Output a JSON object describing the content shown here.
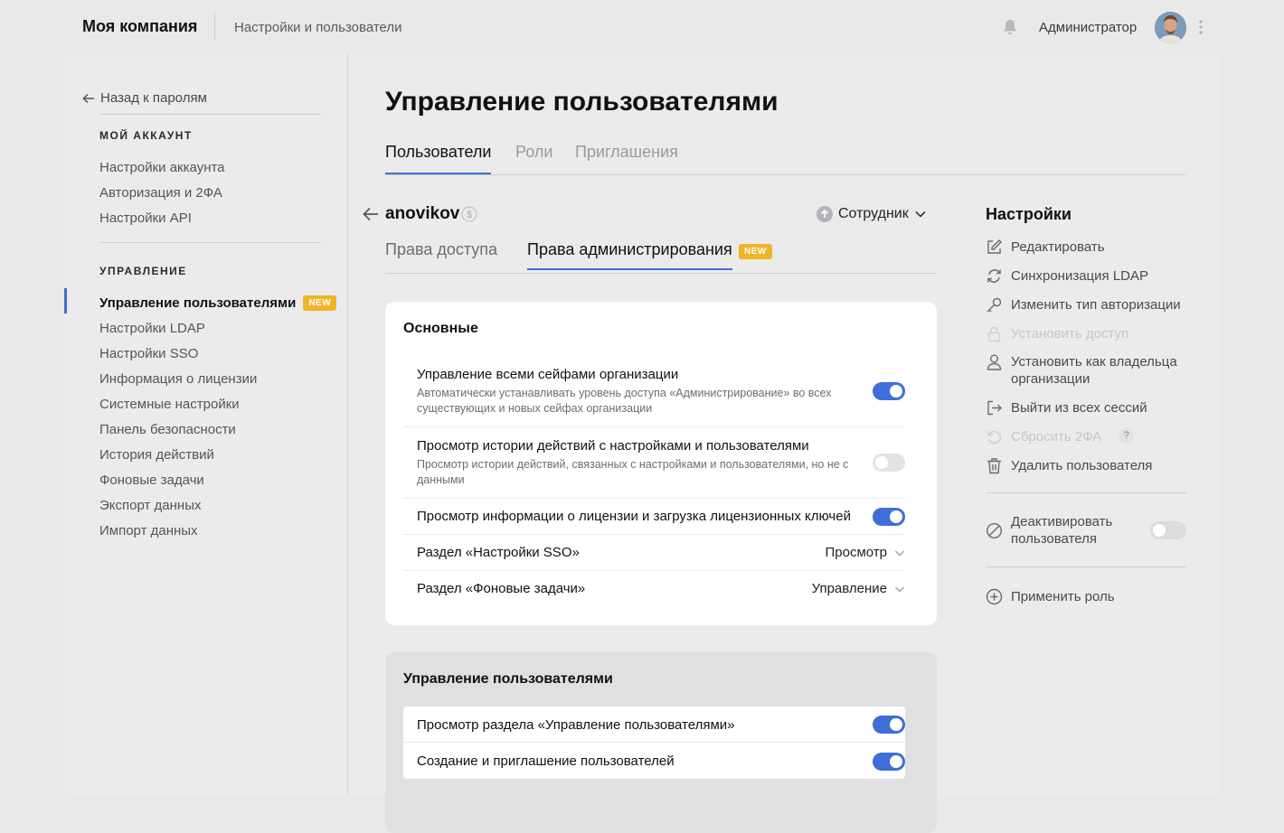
{
  "topbar": {
    "brand": "Моя компания",
    "crumb": "Настройки и пользователи",
    "admin_name": "Администратор"
  },
  "sidebar": {
    "back": "Назад к паролям",
    "section_account": "МОЙ АККАУНТ",
    "account_items": [
      "Настройки аккаунта",
      "Авторизация и 2ФА",
      "Настройки API"
    ],
    "section_manage": "УПРАВЛЕНИЕ",
    "manage_items": [
      "Управление пользователями",
      "Настройки LDAP",
      "Настройки SSO",
      "Информация о лицензии",
      "Системные настройки",
      "Панель безопасности",
      "История действий",
      "Фоновые задачи",
      "Экспорт данных",
      "Импорт данных"
    ],
    "new_badge": "NEW"
  },
  "main": {
    "title": "Управление пользователями",
    "tabs": [
      "Пользователи",
      "Роли",
      "Приглашения"
    ],
    "user": {
      "login": "anovikov",
      "role": "Сотрудник"
    },
    "subtabs": [
      "Права доступа",
      "Права администрирования"
    ],
    "subtab_badge": "NEW",
    "card_basic": {
      "title": "Основные",
      "rows": [
        {
          "title": "Управление всеми сейфами организации",
          "desc": "Автоматически устанавливать уровень доступа «Администрирование» во всех существующих и новых сейфах организации",
          "on": true
        },
        {
          "title": "Просмотр истории действий с настройками и пользователями",
          "desc": "Просмотр истории действий, связанных с настройками и пользователями, но не с данными",
          "on": false
        },
        {
          "title": "Просмотр информации о лицензии и загрузка лицензионных ключей",
          "on": true
        }
      ],
      "selects": [
        {
          "title": "Раздел «Настройки SSO»",
          "value": "Просмотр"
        },
        {
          "title": "Раздел «Фоновые задачи»",
          "value": "Управление"
        }
      ]
    },
    "card_users": {
      "title": "Управление пользователями",
      "rows": [
        {
          "title": "Просмотр раздела «Управление пользователями»",
          "on": true
        },
        {
          "title": "Создание и приглашение пользователей",
          "on": true
        }
      ]
    }
  },
  "settings": {
    "title": "Настройки",
    "actions": [
      {
        "label": "Редактировать",
        "icon": "edit-icon"
      },
      {
        "label": "Синхронизация LDAP",
        "icon": "sync-icon"
      },
      {
        "label": "Изменить тип авторизации",
        "icon": "key-icon"
      },
      {
        "label": "Установить доступ",
        "icon": "lock-icon",
        "disabled": true
      },
      {
        "label": "Установить как владельца организации",
        "icon": "user-icon"
      },
      {
        "label": "Выйти из всех сессий",
        "icon": "logout-icon"
      },
      {
        "label": "Сбросить 2ФА",
        "icon": "reset-icon",
        "disabled": true
      },
      {
        "label": "Удалить пользователя",
        "icon": "trash-icon"
      }
    ],
    "help": "?",
    "deactivate": "Деактивировать пользователя",
    "apply_role": "Применить роль"
  }
}
